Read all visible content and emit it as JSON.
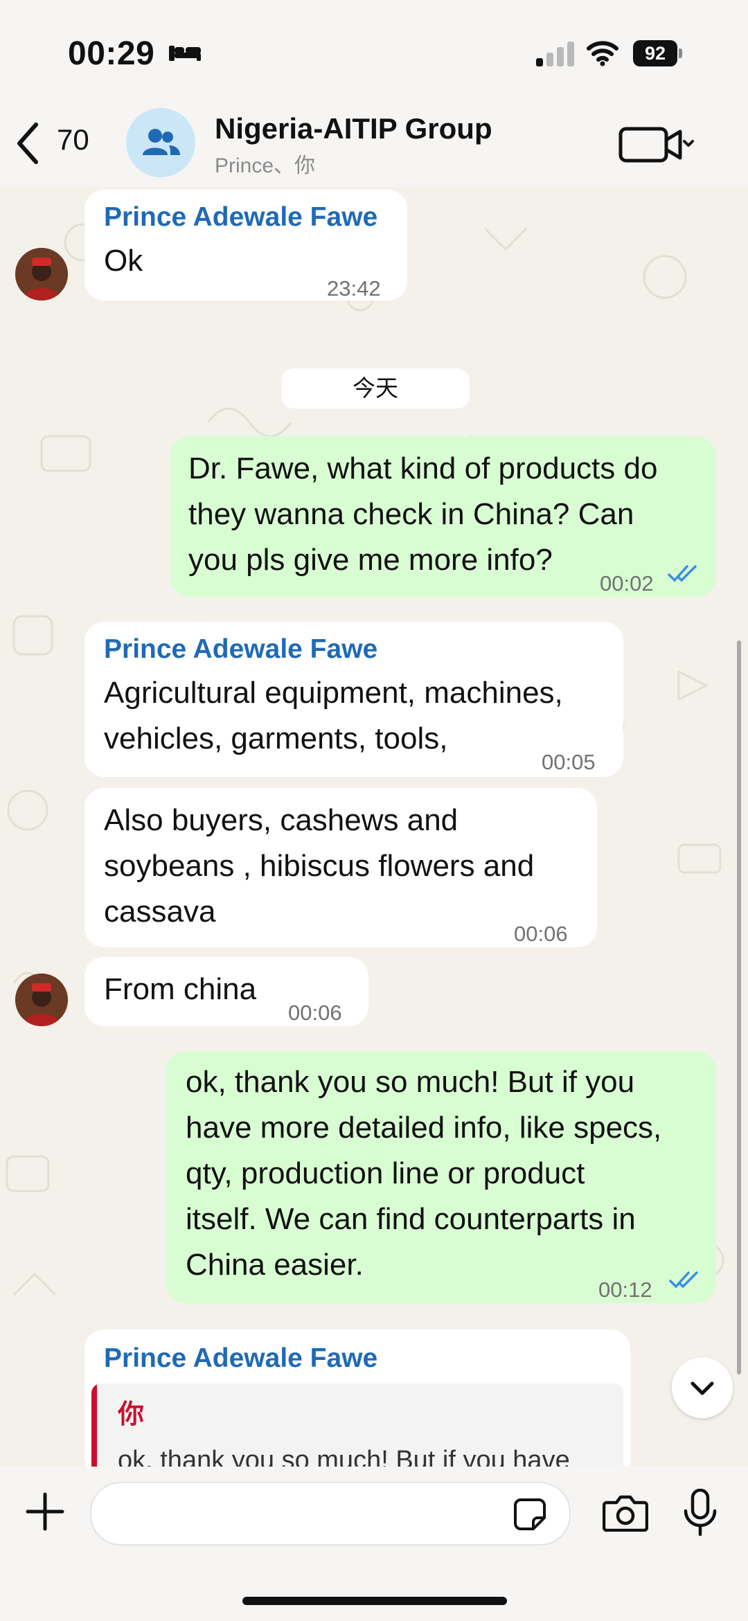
{
  "status_bar": {
    "time": "00:29",
    "battery": "92"
  },
  "header": {
    "back_count": "70",
    "group_name": "Nigeria-AITIP Group",
    "members": "Prince、你"
  },
  "chat": {
    "date_divider": "今天",
    "messages": [
      {
        "dir": "in",
        "sender": "Prince Adewale Fawe",
        "lines": [
          "Ok"
        ],
        "time": "23:42"
      },
      {
        "dir": "out",
        "lines": [
          "Dr. Fawe, what kind of products do",
          "they wanna check in China? Can",
          "you pls give me more info?"
        ],
        "time": "00:02"
      },
      {
        "dir": "in",
        "sender": "Prince Adewale Fawe",
        "lines": [
          "Agricultural equipment, machines,",
          "vehicles, garments, tools,"
        ],
        "time": "00:05"
      },
      {
        "dir": "in",
        "lines": [
          "Also buyers, cashews and",
          "soybeans , hibiscus flowers and",
          "cassava"
        ],
        "time": "00:06"
      },
      {
        "dir": "in",
        "lines": [
          "From china"
        ],
        "time": "00:06"
      },
      {
        "dir": "out",
        "lines": [
          "ok, thank you so much! But if you",
          "have more detailed info, like specs,",
          "qty, production line or product",
          "itself. We can find counterparts in",
          "China easier."
        ],
        "time": "00:12"
      },
      {
        "dir": "in",
        "sender": "Prince Adewale Fawe",
        "quote_author": "你",
        "quote_text": "ok, thank you so much! But if you have"
      }
    ]
  },
  "icons": {
    "back": "chevron-left-icon",
    "group": "group-icon",
    "video": "video-call-icon",
    "plus": "plus-icon",
    "sticker": "sticker-icon",
    "camera": "camera-icon",
    "mic": "microphone-icon",
    "scroll": "chevron-down-icon"
  },
  "colors": {
    "outgoing_bubble": "#d9fdd3",
    "incoming_bubble": "#ffffff",
    "sender_name": "#1f6ab5",
    "read_ticks": "#3a8ee6",
    "quote_bar": "#c8102e"
  }
}
